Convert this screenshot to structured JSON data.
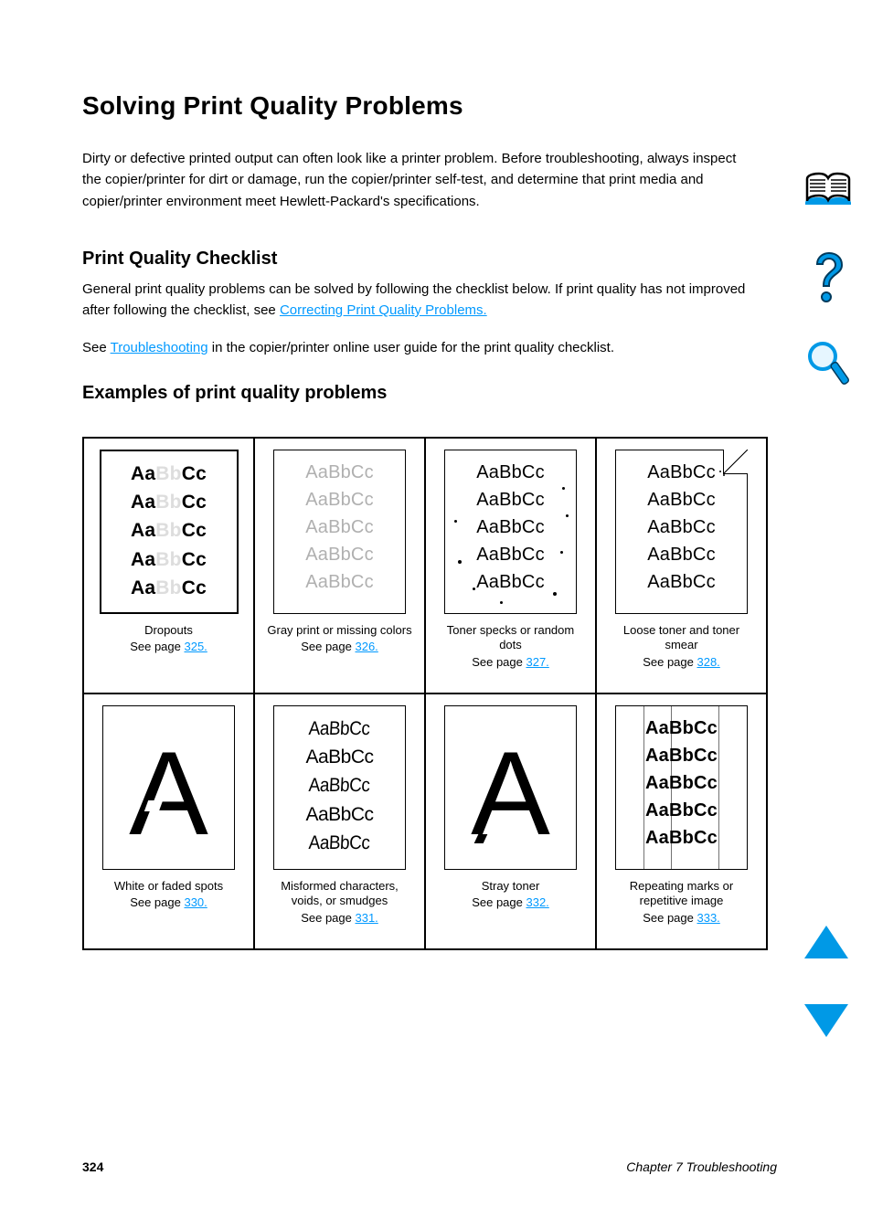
{
  "title": "Solving Print Quality Problems",
  "intro": "Dirty or defective printed output can often look like a printer problem. Before troubleshooting, always inspect the copier/printer for dirt or damage, run the copier/printer self-test, and determine that print media and copier/printer environment meet Hewlett-Packard's specifications.",
  "checklist_title": "Print Quality Checklist",
  "body1_pre": "General print quality problems can be solved by following the checklist below. If print quality has not improved after following the checklist, see ",
  "body1_link": "Correcting Print Quality Problems.",
  "body2_pre": "See ",
  "body2_link": "Troubleshooting",
  "body2_post": " in the copier/printer online user guide for the print quality checklist.",
  "examples_title": "Examples of print quality problems",
  "sample_text": "AaBbCc",
  "cells": [
    {
      "caption": "Dropouts",
      "see": "See page ",
      "page": "325."
    },
    {
      "caption": "Gray print or missing colors",
      "see": "See page ",
      "page": "326."
    },
    {
      "caption": "Toner specks or random dots",
      "see": "See page ",
      "page": "327."
    },
    {
      "caption": "Loose toner and toner smear",
      "see": "See page ",
      "page": "328."
    },
    {
      "caption": "White or faded spots",
      "see": "See page ",
      "page": "330."
    },
    {
      "caption": "Misformed characters, voids, or smudges",
      "see": "See page ",
      "page": "331."
    },
    {
      "caption": "Stray toner",
      "see": "See page ",
      "page": "332."
    },
    {
      "caption": "Repeating marks or repetitive image",
      "see": "See page ",
      "page": "333."
    }
  ],
  "sidebar": {
    "book": "contents-icon",
    "help": "help-icon",
    "search": "search-icon"
  },
  "nav": {
    "up": "page-up",
    "down": "page-down"
  },
  "footer": {
    "page_number": "324",
    "chapter": "Chapter 7  Troubleshooting"
  }
}
